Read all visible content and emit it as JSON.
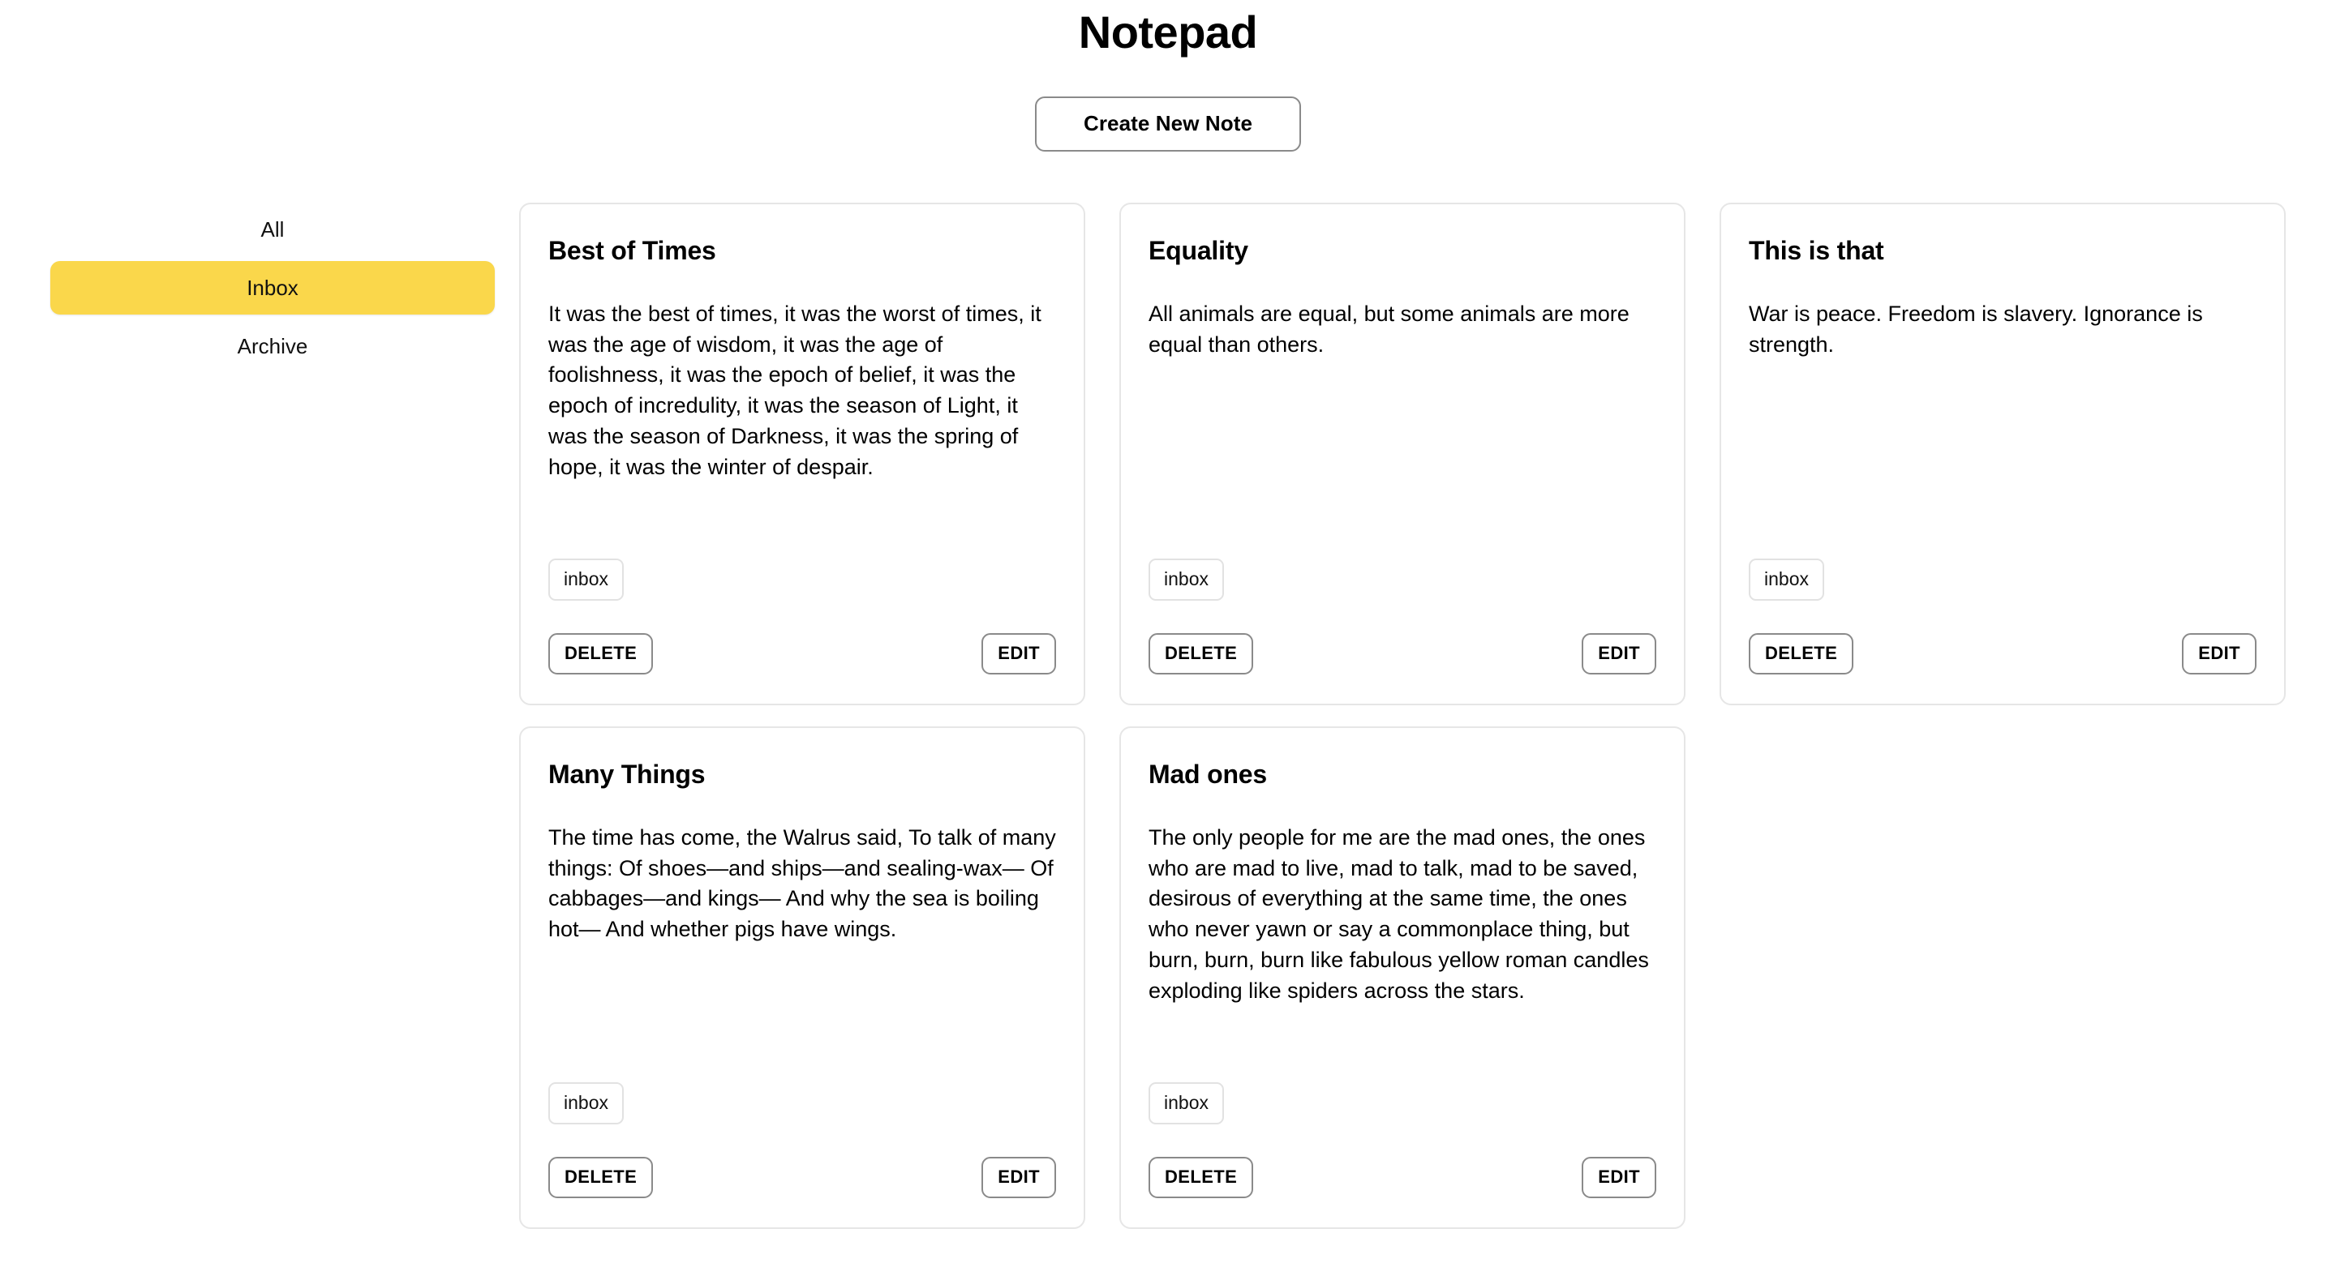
{
  "header": {
    "title": "Notepad",
    "create_button_label": "Create New Note"
  },
  "sidebar": {
    "items": [
      {
        "label": "All",
        "active": false
      },
      {
        "label": "Inbox",
        "active": true
      },
      {
        "label": "Archive",
        "active": false
      }
    ],
    "active_color": "#FAD74B"
  },
  "actions": {
    "delete_label": "DELETE",
    "edit_label": "EDIT"
  },
  "notes": [
    {
      "title": "Best of Times",
      "body": "It was the best of times, it was the worst of times, it was the age of wisdom, it was the age of foolishness, it was the epoch of belief, it was the epoch of incredulity, it was the season of Light, it was the season of Darkness, it was the spring of hope, it was the winter of despair.",
      "tags": [
        "inbox"
      ]
    },
    {
      "title": "Equality",
      "body": "All animals are equal, but some animals are more equal than others.",
      "tags": [
        "inbox"
      ]
    },
    {
      "title": "This is that",
      "body": "War is peace. Freedom is slavery. Ignorance is strength.",
      "tags": [
        "inbox"
      ]
    },
    {
      "title": "Many Things",
      "body": "The time has come, the Walrus said, To talk of many things: Of shoes—and ships—and sealing-wax— Of cabbages—and kings— And why the sea is boiling hot— And whether pigs have wings.",
      "tags": [
        "inbox"
      ]
    },
    {
      "title": "Mad ones",
      "body": "The only people for me are the mad ones, the ones who are mad to live, mad to talk, mad to be saved, desirous of everything at the same time, the ones who never yawn or say a commonplace thing, but burn, burn, burn like fabulous yellow roman candles exploding like spiders across the stars.",
      "tags": [
        "inbox"
      ]
    }
  ]
}
